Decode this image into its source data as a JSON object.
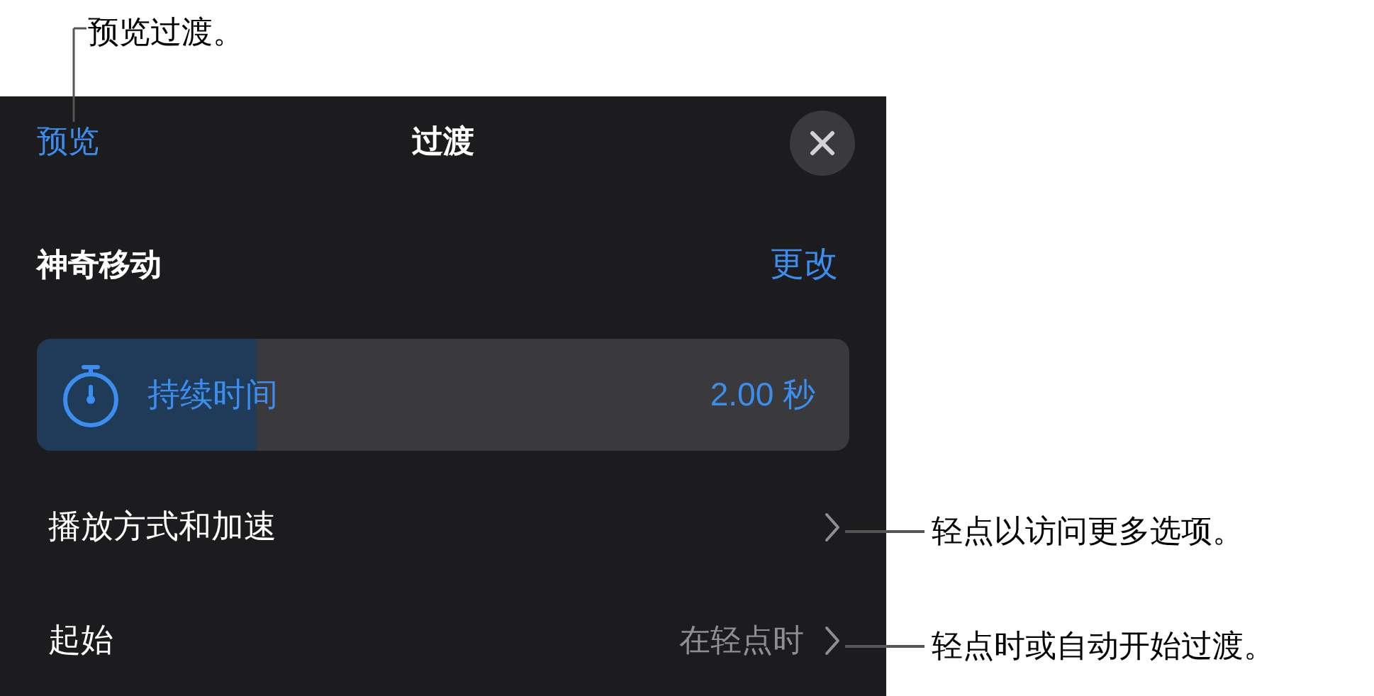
{
  "callouts": [
    {
      "text": "预览过渡。"
    },
    {
      "text": "轻点以访问更多选项。"
    },
    {
      "text": "轻点时或自动开始过渡。"
    }
  ],
  "header": {
    "preview_button": "预览",
    "title": "过渡"
  },
  "effect": {
    "name": "神奇移动",
    "change_button": "更改"
  },
  "duration": {
    "label": "持续时间",
    "reading": "2.00 秒",
    "level": 0.27
  },
  "rows": [
    {
      "label": "播放方式和加速"
    },
    {
      "label": "起始",
      "value": "在轻点时"
    }
  ]
}
